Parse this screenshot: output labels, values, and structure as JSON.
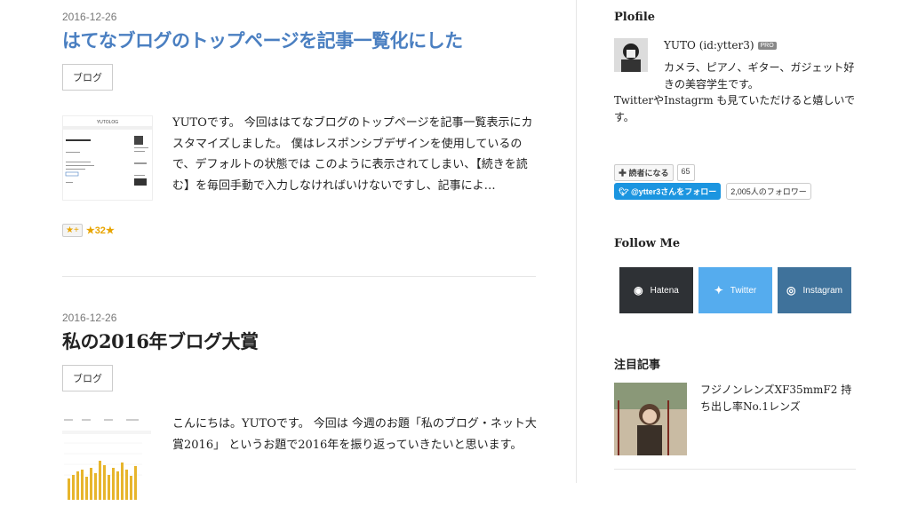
{
  "entries": [
    {
      "date": "2016-12-26",
      "title": "はてなブログのトップページを記事一覧化にした",
      "category": "ブログ",
      "excerpt": "YUTOです。 今回ははてなブログのトップページを記事一覧表示にカスタマイズしました。 僕はレスポンシブデザインを使用しているので、デフォルトの状態では このように表示されてしまい、【続きを読む】を毎回手動で入力しなければいけないですし、記事によ…",
      "thumb_heading": "YUTOLOG",
      "star_button": "★+",
      "star_count": "32"
    },
    {
      "date": "2016-12-26",
      "title": "私の2016年ブログ大賞",
      "category": "ブログ",
      "excerpt": "こんにちは。YUTOです。 今回は 今週のお題「私のブログ・ネット大賞2016」 というお題で2016年を振り返っていきたいと思います。"
    }
  ],
  "sidebar": {
    "profile_heading": "Plofile",
    "profile_name": "YUTO (id:ytter3)",
    "pro_badge": "PRO",
    "profile_desc1": "カメラ、ピアノ、ギター、ガジェット好きの美容学生です。",
    "profile_desc2": "TwitterやInstagrm も見ていただけると嬉しいです。",
    "subscribe_label": "読者になる",
    "subscribe_count": "65",
    "twitter_follow": "@ytter3さんをフォロー",
    "twitter_count": "2,005人のフォロワー",
    "follow_heading": "Follow Me",
    "follow_buttons": [
      {
        "label": "Hatena",
        "icon": "hatena-icon",
        "color": "#2e3135"
      },
      {
        "label": "Twitter",
        "icon": "twitter-icon",
        "color": "#55acee"
      },
      {
        "label": "Instagram",
        "icon": "instagram-icon",
        "color": "#3f729b"
      }
    ],
    "popular_heading": "注目記事",
    "popular_title": "フジノンレンズXF35mmF2 持ち出し率No.1レンズ"
  }
}
